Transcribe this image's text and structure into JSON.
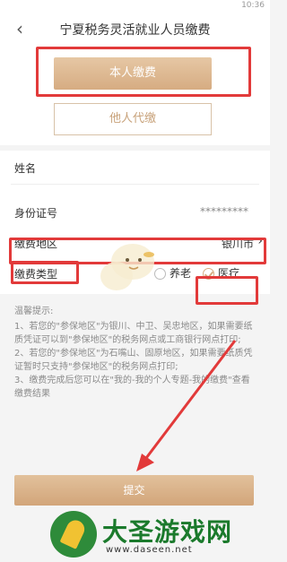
{
  "status_bar": {
    "time": "10:36"
  },
  "header": {
    "back_icon": "chevron-left-icon",
    "title": "宁夏税务灵活就业人员缴费"
  },
  "mode_buttons": {
    "self": "本人缴费",
    "other": "他人代缴"
  },
  "form": {
    "name_label": "姓名",
    "id_label": "身份证号",
    "id_value": "*********",
    "region_label": "缴费地区",
    "region_value": "银川市",
    "type_label": "缴费类型",
    "type_options": [
      "养老",
      "医疗"
    ],
    "type_selected": "医疗"
  },
  "tips": {
    "title": "温馨提示:",
    "items": [
      "1、若您的\"参保地区\"为银川、中卫、吴忠地区，如果需要纸质凭证可以到\"参保地区\"的税务网点或工商银行网点打印;",
      "2、若您的\"参保地区\"为石嘴山、固原地区，如果需要纸质凭证暂时只支持\"参保地区\"的税务网点打印;",
      "3、缴费完成后您可以在\"我的-我的个人专题-我的缴费\"查看缴费结果"
    ]
  },
  "submit_label": "提交",
  "watermark": {
    "name": "大圣游戏网",
    "url": "www.daseen.net"
  },
  "colors": {
    "accent": "#d6ac82",
    "highlight": "#e23a3a"
  }
}
